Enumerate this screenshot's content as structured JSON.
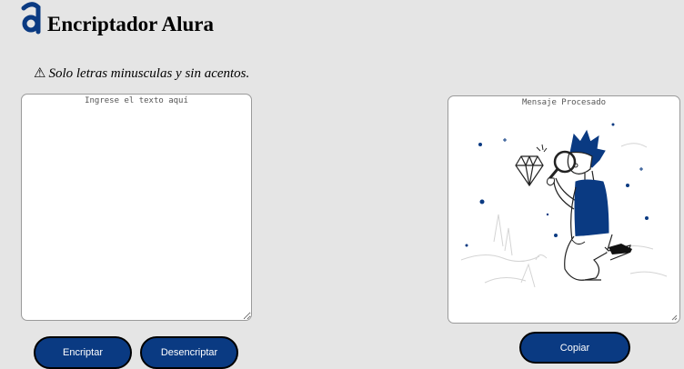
{
  "header": {
    "logo_icon": "alura-logo-icon",
    "title": "Encriptador Alura"
  },
  "warning": {
    "icon": "warning-icon",
    "icon_glyph": "⚠",
    "text": "Solo letras minusculas y sin acentos."
  },
  "input": {
    "placeholder": "Ingrese el texto aquí",
    "value": ""
  },
  "output": {
    "label": "Mensaje Procesado",
    "illustration": "person-with-magnifying-glass-and-diamond"
  },
  "buttons": {
    "encrypt": "Encriptar",
    "decrypt": "Desencriptar",
    "copy": "Copiar"
  },
  "colors": {
    "background": "#e5e5e5",
    "accent": "#0a3a82",
    "panel": "#ffffff"
  }
}
